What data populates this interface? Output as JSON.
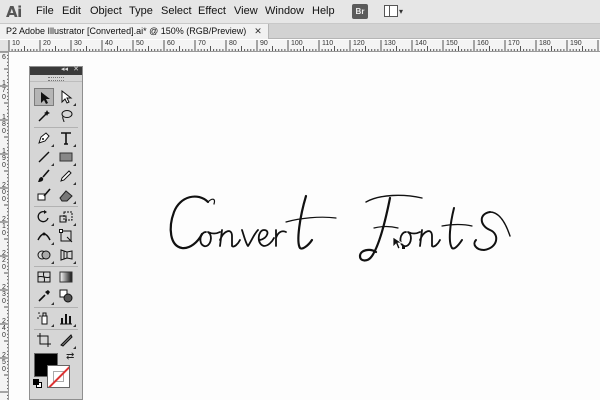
{
  "app": {
    "logo": "Ai"
  },
  "menu": [
    "File",
    "Edit",
    "Object",
    "Type",
    "Select",
    "Effect",
    "View",
    "Window",
    "Help"
  ],
  "toolbar": {
    "bridge_label": "Br"
  },
  "document": {
    "tab_title": "P2 Adobe Illustrator [Converted].ai* @ 150% (RGB/Preview)",
    "close_glyph": "✕"
  },
  "ruler_h": [
    "10",
    "20",
    "30",
    "40",
    "50",
    "60",
    "70",
    "80",
    "90",
    "100",
    "110",
    "120",
    "130",
    "140",
    "150",
    "160",
    "170",
    "180",
    "190"
  ],
  "ruler_v": [
    "6",
    "1 7 0",
    "1 8 0",
    "1 9 0",
    "2 0 0",
    "2 1 0",
    "2 2 0",
    "2 3 0",
    "2 4 0",
    "2 5 0"
  ],
  "artwork": {
    "text": "Convert Fonts",
    "color": "#111111"
  },
  "tools": {
    "header_collapse": "◂◂",
    "header_close": "✕",
    "items": [
      {
        "name": "selection-tool",
        "icon": "selection-icon"
      },
      {
        "name": "direct-selection-tool",
        "icon": "direct-selection-icon"
      },
      {
        "name": "magic-wand-tool",
        "icon": "magic-wand-icon"
      },
      {
        "name": "lasso-tool",
        "icon": "lasso-icon"
      },
      {
        "name": "pen-tool",
        "icon": "pen-icon"
      },
      {
        "name": "type-tool",
        "icon": "type-icon"
      },
      {
        "name": "line-tool",
        "icon": "line-icon"
      },
      {
        "name": "rectangle-tool",
        "icon": "rectangle-icon"
      },
      {
        "name": "paintbrush-tool",
        "icon": "paintbrush-icon"
      },
      {
        "name": "pencil-tool",
        "icon": "pencil-icon"
      },
      {
        "name": "blob-brush-tool",
        "icon": "blob-brush-icon"
      },
      {
        "name": "eraser-tool",
        "icon": "eraser-icon"
      },
      {
        "name": "rotate-tool",
        "icon": "rotate-icon"
      },
      {
        "name": "scale-tool",
        "icon": "scale-icon"
      },
      {
        "name": "width-tool",
        "icon": "width-icon"
      },
      {
        "name": "free-transform-tool",
        "icon": "free-transform-icon"
      },
      {
        "name": "shape-builder-tool",
        "icon": "shape-builder-icon"
      },
      {
        "name": "perspective-grid-tool",
        "icon": "perspective-grid-icon"
      },
      {
        "name": "mesh-tool",
        "icon": "mesh-icon"
      },
      {
        "name": "gradient-tool",
        "icon": "gradient-icon"
      },
      {
        "name": "eyedropper-tool",
        "icon": "eyedropper-icon"
      },
      {
        "name": "blend-tool",
        "icon": "blend-icon"
      },
      {
        "name": "symbol-sprayer-tool",
        "icon": "symbol-sprayer-icon"
      },
      {
        "name": "column-graph-tool",
        "icon": "column-graph-icon"
      },
      {
        "name": "artboard-tool",
        "icon": "artboard-icon"
      },
      {
        "name": "slice-tool",
        "icon": "slice-icon"
      },
      {
        "name": "hand-tool",
        "icon": "hand-icon"
      },
      {
        "name": "zoom-tool",
        "icon": "zoom-icon"
      }
    ],
    "fill_color": "#000000",
    "stroke_color": "none"
  }
}
